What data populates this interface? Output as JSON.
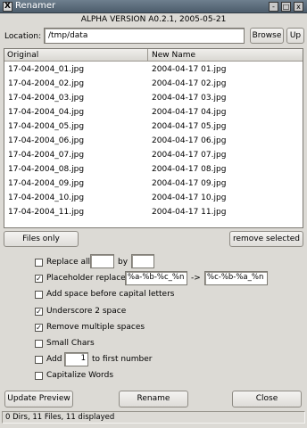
{
  "window": {
    "title": "Renamer",
    "controls": [
      "-",
      "□",
      "x"
    ]
  },
  "version": "ALPHA VERSION A0.2.1, 2005-05-21",
  "location": {
    "label": "Location:",
    "value": "/tmp/data",
    "browse_label": "Browse",
    "up_label": "Up"
  },
  "table": {
    "columns": [
      "Original",
      "New Name"
    ],
    "rows": [
      [
        "17-04-2004_01.jpg",
        "2004-04-17 01.jpg"
      ],
      [
        "17-04-2004_02.jpg",
        "2004-04-17 02.jpg"
      ],
      [
        "17-04-2004_03.jpg",
        "2004-04-17 03.jpg"
      ],
      [
        "17-04-2004_04.jpg",
        "2004-04-17 04.jpg"
      ],
      [
        "17-04-2004_05.jpg",
        "2004-04-17 05.jpg"
      ],
      [
        "17-04-2004_06.jpg",
        "2004-04-17 06.jpg"
      ],
      [
        "17-04-2004_07.jpg",
        "2004-04-17 07.jpg"
      ],
      [
        "17-04-2004_08.jpg",
        "2004-04-17 08.jpg"
      ],
      [
        "17-04-2004_09.jpg",
        "2004-04-17 09.jpg"
      ],
      [
        "17-04-2004_10.jpg",
        "2004-04-17 10.jpg"
      ],
      [
        "17-04-2004_11.jpg",
        "2004-04-17 11.jpg"
      ]
    ]
  },
  "list_buttons": {
    "files_only": "Files only",
    "remove_selected": "remove selected"
  },
  "options": {
    "replace_all": {
      "label": "Replace all",
      "checked": false,
      "from_value": "",
      "by_label": "by",
      "to_value": ""
    },
    "placeholder_replace": {
      "label": "Placeholder replace",
      "checked": true,
      "pattern_value": "%a-%b-%c_%n",
      "arrow": "->",
      "result_value": "%c-%b-%a_%n"
    },
    "add_space_capitals": {
      "label": "Add space before capital letters",
      "checked": false
    },
    "underscore_space": {
      "label": "Underscore 2 space",
      "checked": true
    },
    "remove_multiple_spaces": {
      "label": "Remove multiple spaces",
      "checked": true
    },
    "small_chars": {
      "label": "Small Chars",
      "checked": false
    },
    "add_number": {
      "label": "Add",
      "checked": false,
      "value": "1",
      "suffix_label": "to first number"
    },
    "capitalize_words": {
      "label": "Capitalize Words",
      "checked": false
    }
  },
  "actions": {
    "update_preview": "Update Preview",
    "rename": "Rename",
    "close": "Close"
  },
  "status": "0 Dirs, 11 Files, 11 displayed"
}
